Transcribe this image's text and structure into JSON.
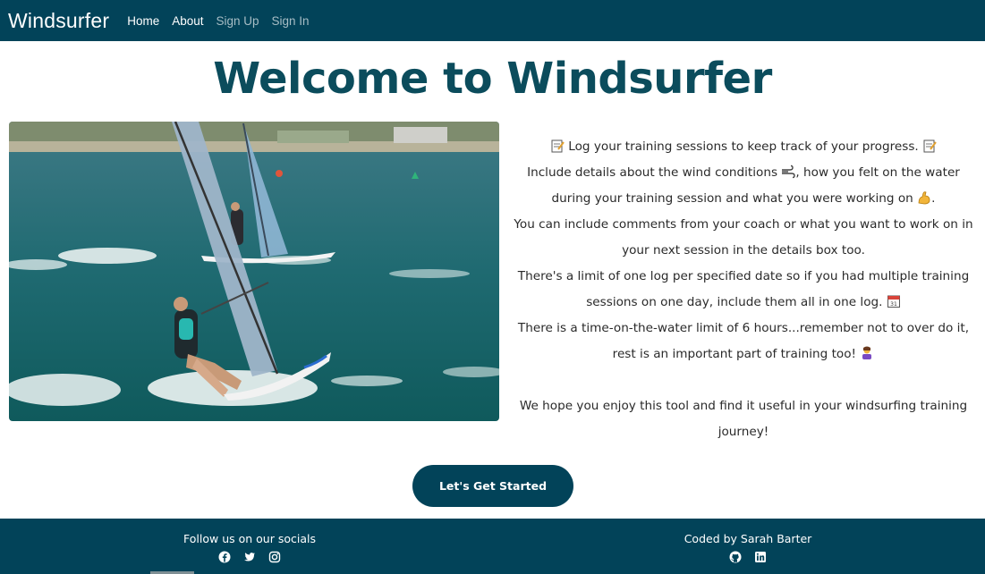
{
  "nav": {
    "brand": "Windsurfer",
    "links": [
      {
        "label": "Home"
      },
      {
        "label": "About"
      },
      {
        "label": "Sign Up"
      },
      {
        "label": "Sign In"
      }
    ]
  },
  "main": {
    "title": "Welcome to Windsurfer",
    "intro": {
      "line1": "Log your training sessions to keep track of your progress.",
      "line2a": "Include details about the wind conditions",
      "line2b": ", how you felt on the water during your training session and what you were working on",
      "line2c": ".",
      "line3": "You can include comments from your coach or what you want to work on in your next session in the details box too.",
      "line4": "There's a limit of one log per specified date so if you had multiple training sessions on one day, include them all in one log.",
      "line5": "There is a time-on-the-water limit of 6 hours...remember not to over do it, rest is an important part of training too!",
      "line6": "We hope you enjoy this tool and find it useful in your windsurfing training journey!"
    },
    "cta_label": "Let's Get Started"
  },
  "footer": {
    "socials_label": "Follow us on our socials",
    "credit_label": "Coded by Sarah Barter",
    "social_icons": [
      "facebook-icon",
      "twitter-icon",
      "instagram-icon"
    ],
    "credit_icons": [
      "github-icon",
      "linkedin-icon"
    ]
  },
  "colors": {
    "navbar": "#024359",
    "title": "#0b4c5c",
    "button": "#024359",
    "footer": "#024359"
  }
}
